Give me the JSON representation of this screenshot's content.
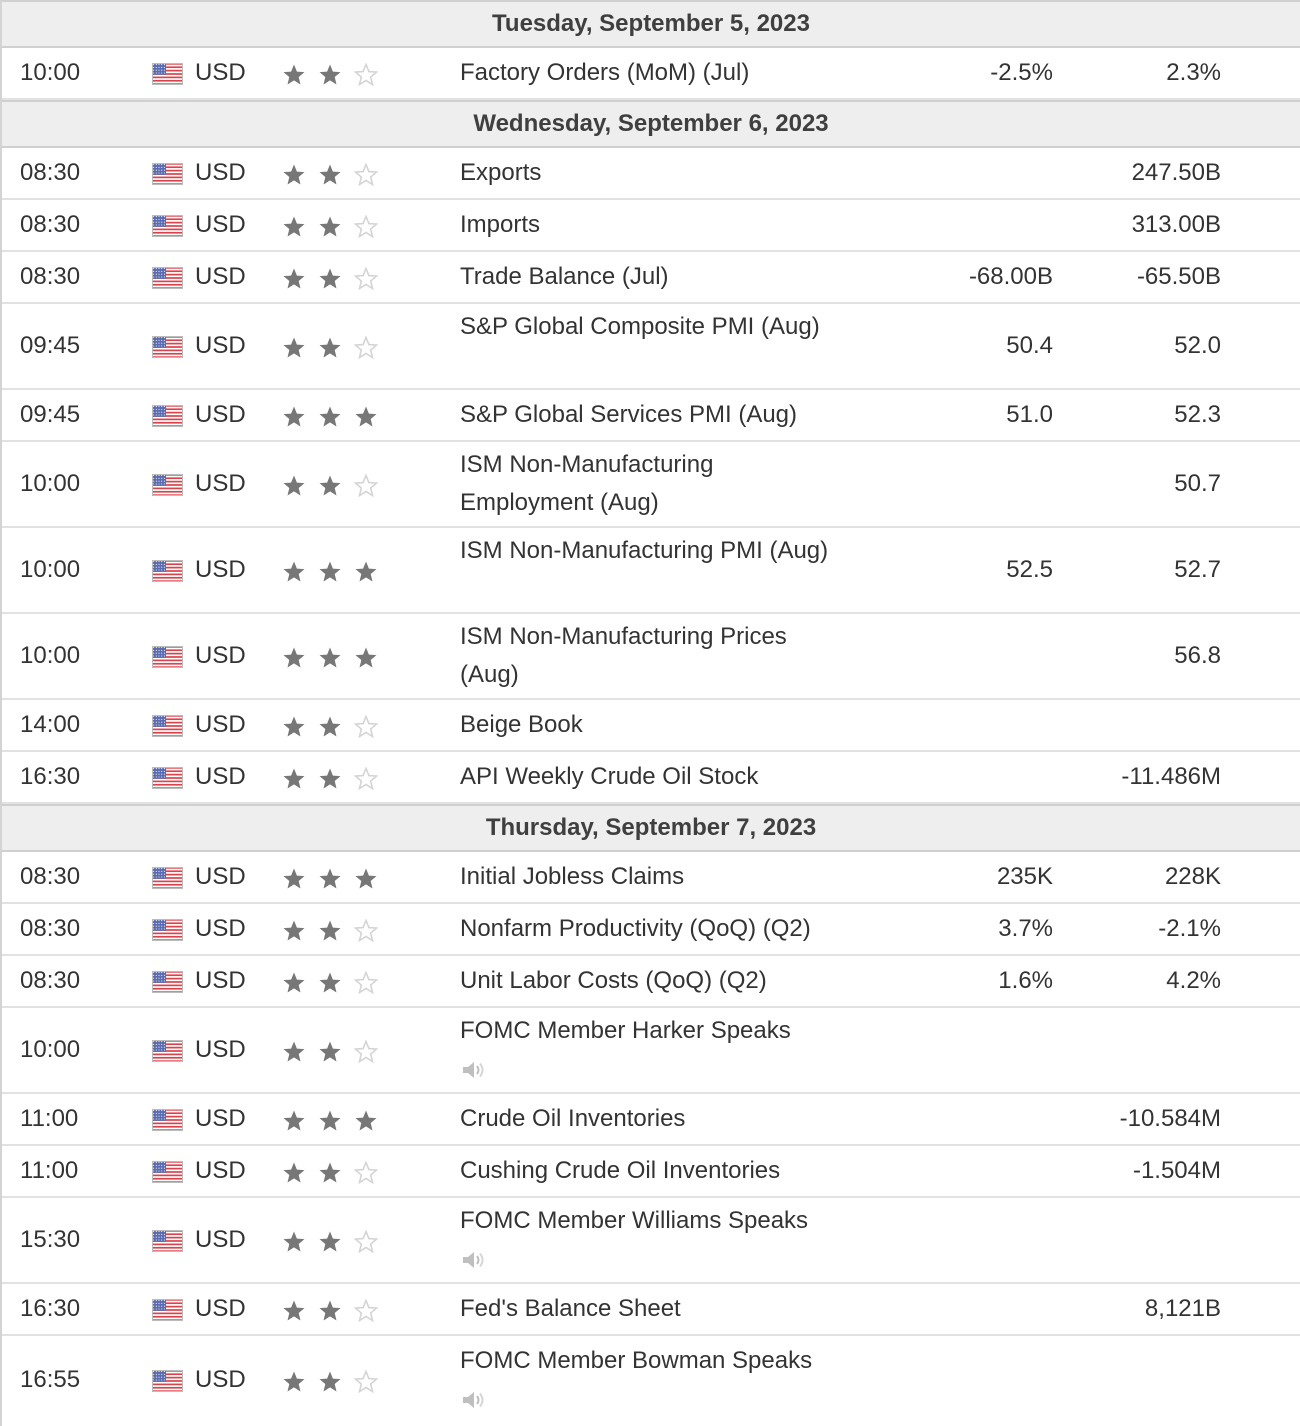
{
  "days": [
    {
      "label": "Tuesday, September 5, 2023"
    },
    {
      "label": "Wednesday, September 6, 2023"
    },
    {
      "label": "Thursday, September 7, 2023"
    }
  ],
  "events": [
    {
      "time": "10:00",
      "currency": "USD",
      "stars": 2,
      "name": "Factory Orders (MoM) (Jul)",
      "forecast": "-2.5%",
      "previous": "2.3%"
    },
    {
      "time": "08:30",
      "currency": "USD",
      "stars": 2,
      "name": "Exports",
      "forecast": "",
      "previous": "247.50B"
    },
    {
      "time": "08:30",
      "currency": "USD",
      "stars": 2,
      "name": "Imports",
      "forecast": "",
      "previous": "313.00B"
    },
    {
      "time": "08:30",
      "currency": "USD",
      "stars": 2,
      "name": "Trade Balance (Jul)",
      "forecast": "-68.00B",
      "previous": "-65.50B"
    },
    {
      "time": "09:45",
      "currency": "USD",
      "stars": 2,
      "name": "S&P Global Composite PMI (Aug)",
      "forecast": "50.4",
      "previous": "52.0"
    },
    {
      "time": "09:45",
      "currency": "USD",
      "stars": 3,
      "name": "S&P Global Services PMI (Aug)",
      "forecast": "51.0",
      "previous": "52.3"
    },
    {
      "time": "10:00",
      "currency": "USD",
      "stars": 2,
      "name": "ISM Non-Manufacturing Employment (Aug)",
      "forecast": "",
      "previous": "50.7"
    },
    {
      "time": "10:00",
      "currency": "USD",
      "stars": 3,
      "name": "ISM Non-Manufacturing PMI (Aug)",
      "forecast": "52.5",
      "previous": "52.7"
    },
    {
      "time": "10:00",
      "currency": "USD",
      "stars": 3,
      "name": "ISM Non-Manufacturing Prices (Aug)",
      "forecast": "",
      "previous": "56.8"
    },
    {
      "time": "14:00",
      "currency": "USD",
      "stars": 2,
      "name": "Beige Book",
      "forecast": "",
      "previous": ""
    },
    {
      "time": "16:30",
      "currency": "USD",
      "stars": 2,
      "name": "API Weekly Crude Oil Stock",
      "forecast": "",
      "previous": "-11.486M"
    },
    {
      "time": "08:30",
      "currency": "USD",
      "stars": 3,
      "name": "Initial Jobless Claims",
      "forecast": "235K",
      "previous": "228K"
    },
    {
      "time": "08:30",
      "currency": "USD",
      "stars": 2,
      "name": "Nonfarm Productivity (QoQ) (Q2)",
      "forecast": "3.7%",
      "previous": "-2.1%"
    },
    {
      "time": "08:30",
      "currency": "USD",
      "stars": 2,
      "name": "Unit Labor Costs (QoQ) (Q2)",
      "forecast": "1.6%",
      "previous": "4.2%"
    },
    {
      "time": "10:00",
      "currency": "USD",
      "stars": 2,
      "name": "FOMC Member Harker Speaks",
      "forecast": "",
      "previous": ""
    },
    {
      "time": "11:00",
      "currency": "USD",
      "stars": 3,
      "name": "Crude Oil Inventories",
      "forecast": "",
      "previous": "-10.584M"
    },
    {
      "time": "11:00",
      "currency": "USD",
      "stars": 2,
      "name": "Cushing Crude Oil Inventories",
      "forecast": "",
      "previous": "-1.504M"
    },
    {
      "time": "15:30",
      "currency": "USD",
      "stars": 2,
      "name": "FOMC Member Williams Speaks",
      "forecast": "",
      "previous": ""
    },
    {
      "time": "16:30",
      "currency": "USD",
      "stars": 2,
      "name": "Fed's Balance Sheet",
      "forecast": "",
      "previous": "8,121B"
    },
    {
      "time": "16:55",
      "currency": "USD",
      "stars": 2,
      "name": "FOMC Member Bowman Speaks",
      "forecast": "",
      "previous": ""
    }
  ],
  "icons": {
    "flag": "us-flag-icon",
    "star": "star-icon",
    "speech": "speaker-icon"
  },
  "colors": {
    "star_filled": "#777777",
    "star_empty": "#d4d4d4",
    "day_header_bg": "#eeeeee"
  }
}
